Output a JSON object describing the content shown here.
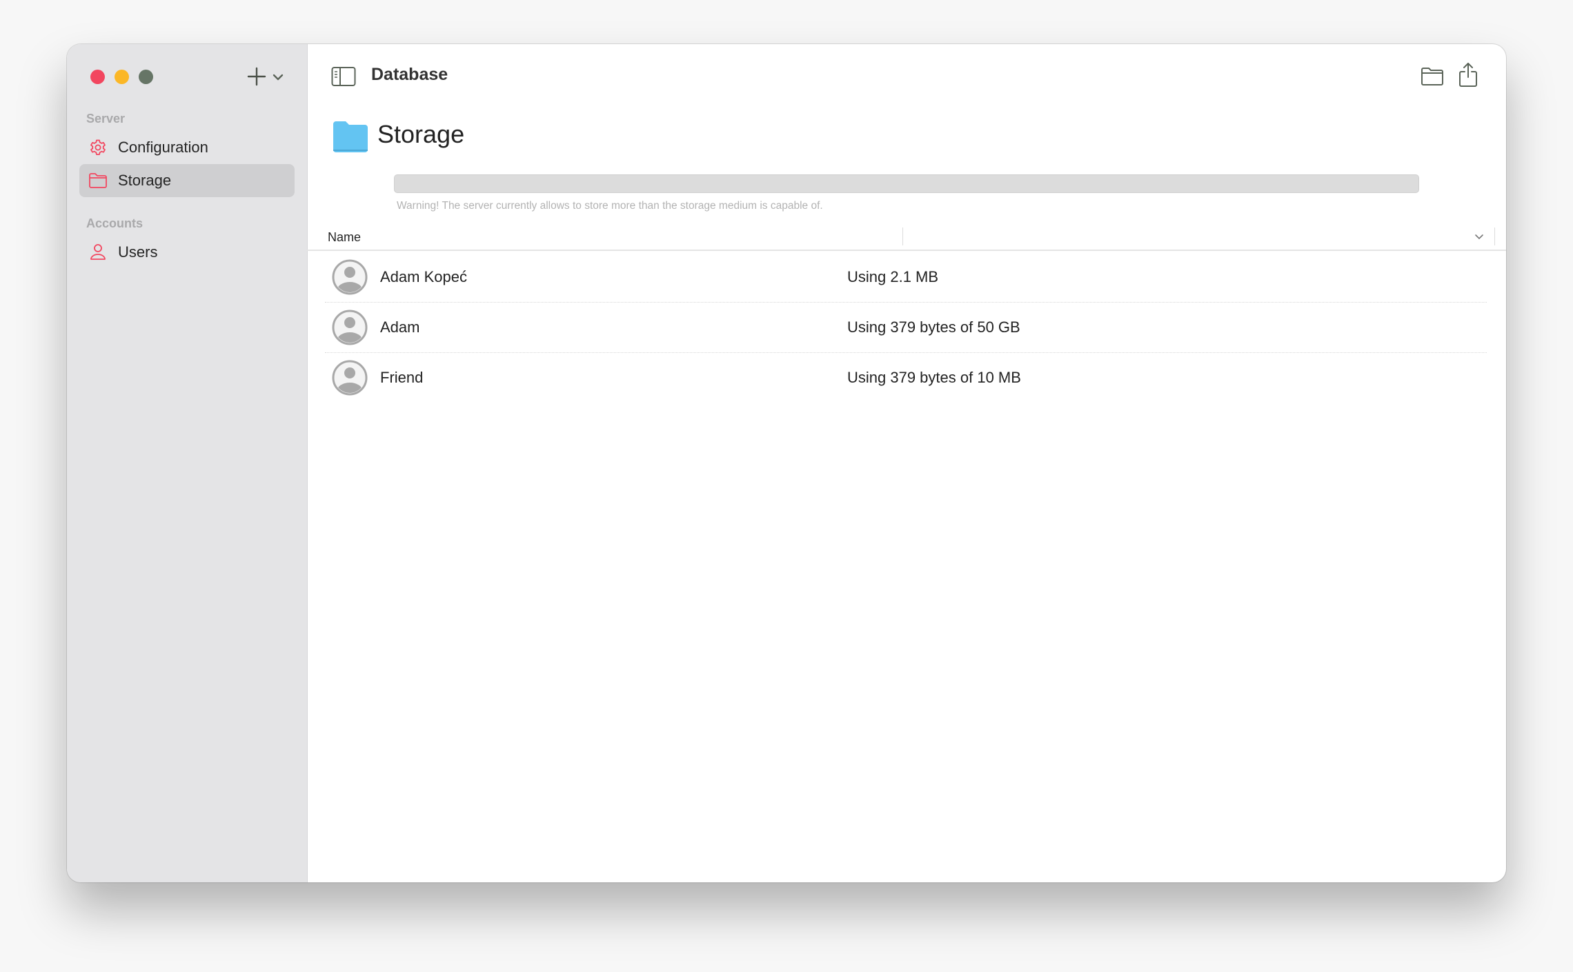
{
  "window": {
    "traffic_lights": [
      "close",
      "minimize",
      "zoom"
    ]
  },
  "sidebar": {
    "add_button": "plus-icon",
    "sections": [
      {
        "title": "Server",
        "items": [
          {
            "label": "Configuration",
            "icon": "gear-icon",
            "selected": false
          },
          {
            "label": "Storage",
            "icon": "folder-icon",
            "selected": true
          }
        ]
      },
      {
        "title": "Accounts",
        "items": [
          {
            "label": "Users",
            "icon": "person-icon",
            "selected": false
          }
        ]
      }
    ]
  },
  "toolbar": {
    "title": "Database",
    "actions": [
      "folder-icon",
      "share-icon"
    ]
  },
  "page": {
    "title": "Storage",
    "progress_fraction": 0.0,
    "warning": "Warning! The server currently allows to store more than the storage medium is capable of."
  },
  "table": {
    "columns": [
      "Name",
      ""
    ],
    "rows": [
      {
        "name": "Adam Kopeć",
        "usage": "Using 2.1 MB"
      },
      {
        "name": "Adam",
        "usage": "Using 379 bytes of 50 GB"
      },
      {
        "name": "Friend",
        "usage": "Using 379 bytes of 10 MB"
      }
    ]
  },
  "colors": {
    "accent": "#f2465f",
    "folder": "#63c4f2",
    "sidebar_bg": "#e4e4e6"
  }
}
